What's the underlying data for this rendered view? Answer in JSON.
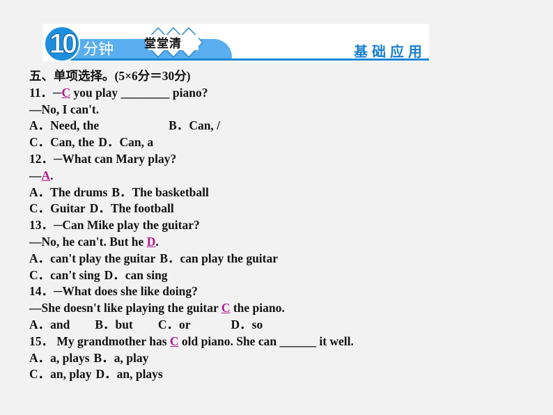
{
  "banner": {
    "number": "10",
    "minutes_label": "分钟",
    "badge_label": "堂堂清",
    "section_label": "基础应用",
    "colors": {
      "primary_blue": "#1e8fdc",
      "light_blue": "#5aaeef",
      "answer_magenta": "#b3198f"
    }
  },
  "section_title": "五、单项选择。(5×6分＝30分)",
  "questions": [
    {
      "number": "11．",
      "stem_pre": "─",
      "answer": "C",
      "stem_post": " you play ________ piano?",
      "reply": "—No, I can't.",
      "options": [
        {
          "letter": "A．",
          "text": "Need, the"
        },
        {
          "letter": "B．",
          "text": "Can, /"
        },
        {
          "letter": "C．",
          "text": "Can, the"
        },
        {
          "letter": "D．",
          "text": "Can, a"
        }
      ]
    },
    {
      "number": "12．",
      "stem": "─What can Mary play?",
      "reply_pre": "—",
      "answer": "A",
      "reply_post": ".",
      "options": [
        {
          "letter": "A．",
          "text": "The drums"
        },
        {
          "letter": "B．",
          "text": "The basketball"
        },
        {
          "letter": "C．",
          "text": "Guitar"
        },
        {
          "letter": "D．",
          "text": "The football"
        }
      ]
    },
    {
      "number": "13．",
      "stem": "─Can Mike play the guitar?",
      "reply_pre": "—No, he can't. But he ",
      "answer": "D",
      "reply_post": ".",
      "options": [
        {
          "letter": "A．",
          "text": "can't play the guitar"
        },
        {
          "letter": "B．",
          "text": "can play the guitar"
        },
        {
          "letter": "C．",
          "text": "can't sing"
        },
        {
          "letter": "D．",
          "text": "can sing"
        }
      ]
    },
    {
      "number": "14．",
      "stem": "─What does she like doing?",
      "reply_pre": "—She doesn't like playing the guitar ",
      "answer": "C",
      "reply_post": " the piano.",
      "options": [
        {
          "letter": "A．",
          "text": "and"
        },
        {
          "letter": "B．",
          "text": "but"
        },
        {
          "letter": "C．",
          "text": "or"
        },
        {
          "letter": "D．",
          "text": "so"
        }
      ]
    },
    {
      "number": "15．",
      "stem_pre": " My grandmother has ",
      "answer": "C",
      "stem_post": " old piano. She can ______ it well.",
      "options": [
        {
          "letter": "A．",
          "text": "a, plays"
        },
        {
          "letter": "B．",
          "text": "a, play"
        },
        {
          "letter": "C．",
          "text": "an, play"
        },
        {
          "letter": "D．",
          "text": "an, plays"
        }
      ]
    }
  ]
}
